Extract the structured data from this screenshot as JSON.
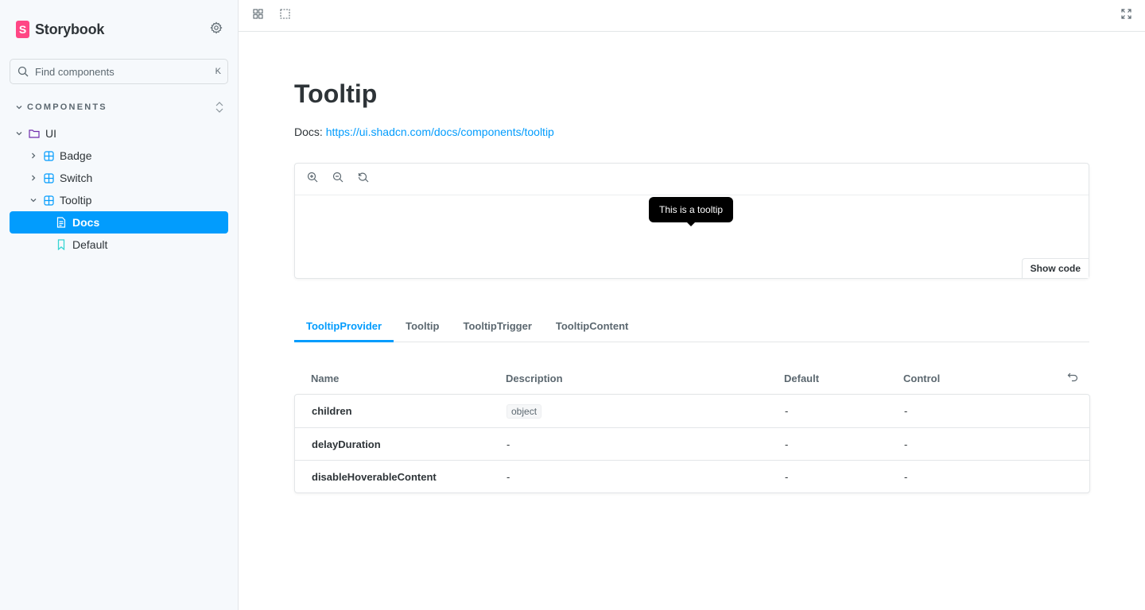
{
  "brand": {
    "name": "Storybook",
    "logo_letter": "S",
    "accent": "#ff4785"
  },
  "search": {
    "placeholder": "Find components",
    "shortcut": "K"
  },
  "sidebar": {
    "section_label": "COMPONENTS",
    "items": [
      {
        "label": "UI",
        "icon": "folder-icon"
      },
      {
        "label": "Badge",
        "icon": "component-icon"
      },
      {
        "label": "Switch",
        "icon": "component-icon"
      },
      {
        "label": "Tooltip",
        "icon": "component-icon"
      },
      {
        "label": "Docs",
        "icon": "document-icon"
      },
      {
        "label": "Default",
        "icon": "bookmark-icon"
      }
    ],
    "active_color": "#029cfd"
  },
  "page": {
    "title": "Tooltip",
    "docs_prefix": "Docs:",
    "docs_link": "https://ui.shadcn.com/docs/components/tooltip"
  },
  "preview": {
    "tooltip_text": "This is a tooltip",
    "show_code_label": "Show code"
  },
  "tabs": [
    {
      "label": "TooltipProvider"
    },
    {
      "label": "Tooltip"
    },
    {
      "label": "TooltipTrigger"
    },
    {
      "label": "TooltipContent"
    }
  ],
  "args_table": {
    "headers": {
      "name": "Name",
      "description": "Description",
      "default": "Default",
      "control": "Control"
    },
    "rows": [
      {
        "name": "children",
        "description": "object",
        "default": "-",
        "control": "-"
      },
      {
        "name": "delayDuration",
        "description": "-",
        "default": "-",
        "control": "-"
      },
      {
        "name": "disableHoverableContent",
        "description": "-",
        "default": "-",
        "control": "-"
      }
    ]
  }
}
